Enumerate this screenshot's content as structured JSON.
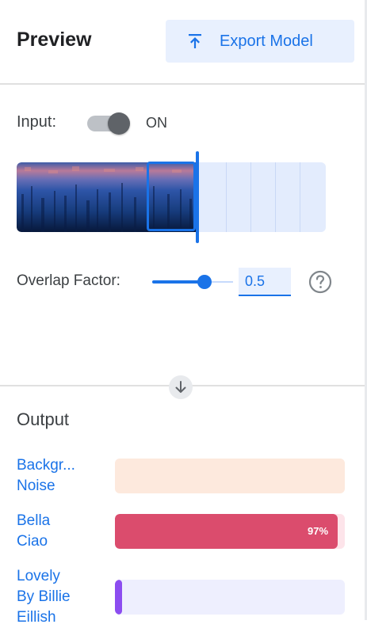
{
  "header": {
    "title": "Preview",
    "export_label": "Export Model",
    "export_icon": "upload-icon"
  },
  "input": {
    "label": "Input:",
    "toggle_state": "ON",
    "toggle_on": true
  },
  "spectrogram": {
    "selection_icon": "spectrogram-window"
  },
  "overlap": {
    "label": "Overlap Factor:",
    "value": "0.5",
    "slider_fraction": 0.5,
    "help_icon": "help-circle-icon"
  },
  "output": {
    "title": "Output",
    "classes": [
      {
        "label_lines": [
          "Backgr...",
          "Noise"
        ],
        "percent_text": "",
        "confidence": 0.0,
        "bar_color": "#fde9dd",
        "fill_color": "#f4a471"
      },
      {
        "label_lines": [
          "Bella",
          "Ciao"
        ],
        "percent_text": "97%",
        "confidence": 0.97,
        "bar_color": "#fde4ea",
        "fill_color": "#db4c6d"
      },
      {
        "label_lines": [
          "Lovely",
          "By Billie",
          "Eillish"
        ],
        "percent_text": "",
        "confidence": 0.03,
        "bar_color": "#eeeffe",
        "fill_color": "#8c4df0"
      }
    ]
  },
  "colors": {
    "accent": "#1a73e8",
    "accent_light": "#e8f0fe"
  }
}
